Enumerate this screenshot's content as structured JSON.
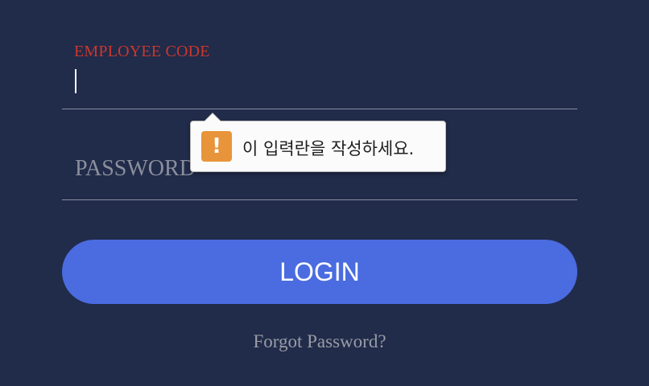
{
  "employee_code": {
    "label": "EMPLOYEE CODE",
    "value": ""
  },
  "password": {
    "placeholder": "PASSWORD",
    "value": ""
  },
  "validation_tooltip": {
    "icon": "warning-icon",
    "message": "이 입력란을 작성하세요."
  },
  "login_button": {
    "label": "LOGIN"
  },
  "forgot_password_link": {
    "label": "Forgot Password?"
  },
  "colors": {
    "background": "#212b4a",
    "label_active": "#c9382f",
    "button": "#4a6ce0",
    "warning": "#e8943a"
  }
}
